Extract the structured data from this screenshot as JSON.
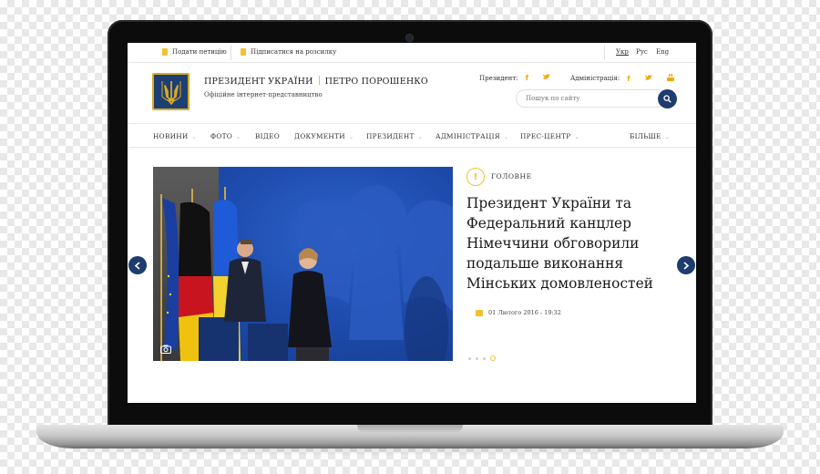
{
  "utility": {
    "petition": "Подати петицію",
    "subscribe": "Підписатися на розсилку",
    "languages": [
      "Укр",
      "Рус",
      "Eng"
    ]
  },
  "header": {
    "title_left": "ПРЕЗИДЕНТ УКРАЇНИ",
    "title_right": "ПЕТРО ПОРОШЕНКО",
    "subtitle": "Офіційне інтернет-представництво",
    "president_label": "Президент:",
    "administration_label": "Адміністрація:",
    "search_placeholder": "Пошук по сайту"
  },
  "nav": [
    {
      "label": "НОВИНИ",
      "dropdown": true
    },
    {
      "label": "ФОТО",
      "dropdown": true
    },
    {
      "label": "ВІДЕО",
      "dropdown": false
    },
    {
      "label": "ДОКУМЕНТИ",
      "dropdown": true
    },
    {
      "label": "ПРЕЗИДЕНТ",
      "dropdown": true
    },
    {
      "label": "АДМІНІСТРАЦІЯ",
      "dropdown": true
    },
    {
      "label": "ПРЕС-ЦЕНТР",
      "dropdown": true
    },
    {
      "label": "БІЛЬШЕ",
      "dropdown": true
    }
  ],
  "slider": {
    "tag_icon": "!",
    "tag": "ГОЛОВНЕ",
    "headline": "Президент України та Федеральний канцлер Німеччини обговорили подальше виконання Мінських домовленостей",
    "date": "01 Лютого 2016 - 19:32",
    "slide_count": 4,
    "active_slide": 4
  },
  "colors": {
    "navy": "#1f3c6e",
    "accent_yellow": "#f2c12e",
    "photo_blue": "#1e4cae"
  },
  "icons": {
    "logo": "trident-icon",
    "facebook": "facebook-icon",
    "twitter": "twitter-icon",
    "youtube": "youtube-icon",
    "search": "search-icon",
    "camera": "camera-icon",
    "calendar": "calendar-icon"
  }
}
